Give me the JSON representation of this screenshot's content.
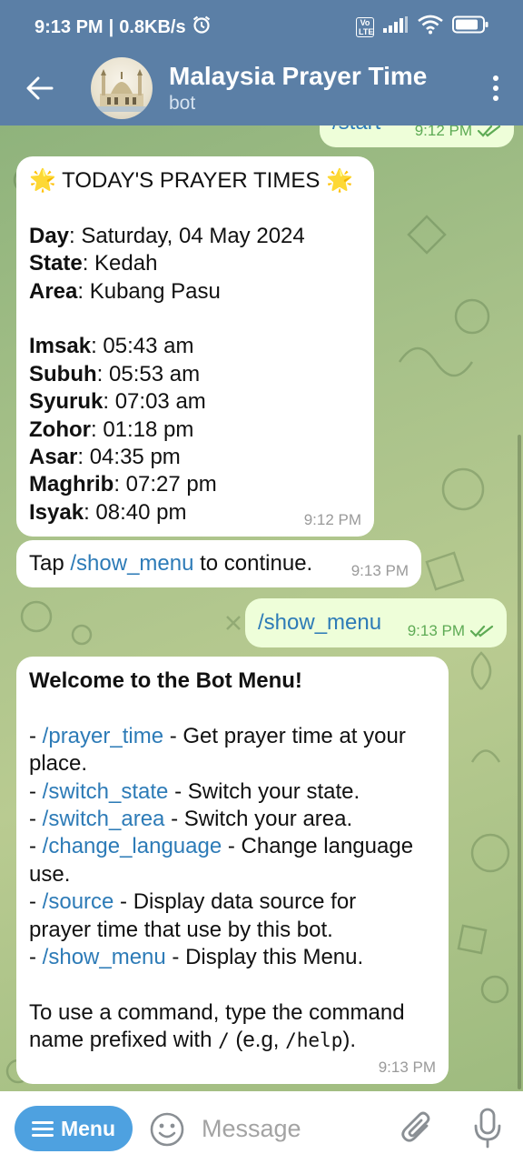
{
  "status": {
    "time": "9:13 PM",
    "separator": "|",
    "speed": "0.8KB/s",
    "volte_label": "Vo LTE"
  },
  "header": {
    "title": "Malaysia Prayer Time",
    "subtitle": "bot"
  },
  "messages": {
    "start": {
      "text": "/start",
      "time": "9:12 PM"
    },
    "prayer": {
      "heading": "TODAY'S PRAYER TIMES",
      "sparkle": "🌟",
      "day_label": "Day",
      "day_value": ": Saturday, 04 May 2024",
      "state_label": "State",
      "state_value": ": Kedah",
      "area_label": "Area",
      "area_value": ": Kubang Pasu",
      "times": [
        {
          "label": "Imsak",
          "value": ": 05:43 am"
        },
        {
          "label": "Subuh",
          "value": ": 05:53 am"
        },
        {
          "label": "Syuruk",
          "value": ": 07:03 am"
        },
        {
          "label": "Zohor",
          "value": ": 01:18 pm"
        },
        {
          "label": "Asar",
          "value": ": 04:35 pm"
        },
        {
          "label": "Maghrib",
          "value": ": 07:27 pm"
        },
        {
          "label": "Isyak",
          "value": ": 08:40 pm"
        }
      ],
      "time": "9:12 PM"
    },
    "tap": {
      "prefix": "Tap ",
      "command": "/show_menu",
      "suffix": " to continue.",
      "time": "9:13 PM"
    },
    "show_menu": {
      "text": "/show_menu",
      "time": "9:13 PM"
    },
    "menu": {
      "heading": "Welcome to the Bot Menu!",
      "items": [
        {
          "dash": "- ",
          "command": "/prayer_time",
          "desc": " - Get prayer time at your",
          "desc2": "place."
        },
        {
          "dash": "- ",
          "command": "/switch_state",
          "desc": " - Switch your state.",
          "desc2": ""
        },
        {
          "dash": "- ",
          "command": "/switch_area",
          "desc": " - Switch your area.",
          "desc2": ""
        },
        {
          "dash": "- ",
          "command": "/change_language",
          "desc": " - Change language",
          "desc2": "use."
        },
        {
          "dash": "- ",
          "command": "/source",
          "desc": " - Display data source for",
          "desc2": "prayer time that use by this bot."
        },
        {
          "dash": "- ",
          "command": "/show_menu",
          "desc": " - Display this Menu.",
          "desc2": ""
        }
      ],
      "footer_line1": "To use a command, type the command",
      "footer_line2_a": "name prefixed with ",
      "footer_slash": "/",
      "footer_line2_b": " (e.g, ",
      "footer_help": "/help",
      "footer_line2_c": ").",
      "time": "9:13 PM"
    }
  },
  "composer": {
    "menu_label": "Menu",
    "placeholder": "Message"
  }
}
